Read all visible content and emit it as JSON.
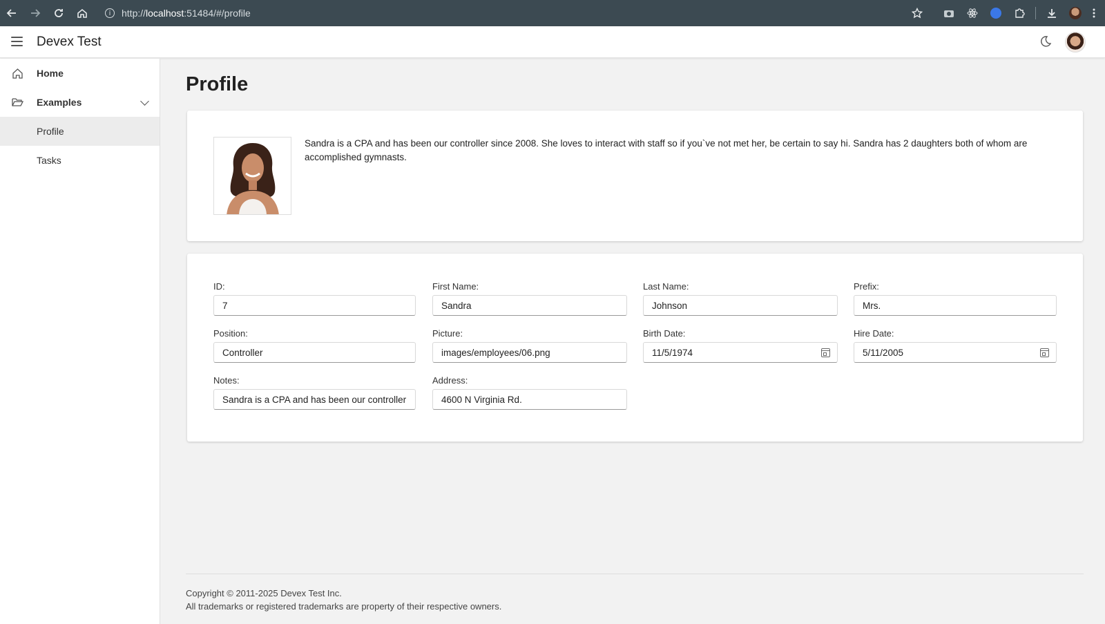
{
  "browser": {
    "url_prefix": "http://",
    "url_host": "localhost",
    "url_rest": ":51484/#/profile"
  },
  "header": {
    "title": "Devex Test"
  },
  "sidebar": {
    "items": [
      {
        "label": "Home"
      },
      {
        "label": "Examples"
      },
      {
        "label": "Profile"
      },
      {
        "label": "Tasks"
      }
    ]
  },
  "page": {
    "title": "Profile"
  },
  "profile": {
    "bio": "Sandra is a CPA and has been our controller since 2008. She loves to interact with staff so if you`ve not met her, be certain to say hi. Sandra has 2 daughters both of whom are accomplished gymnasts."
  },
  "form": {
    "id_label": "ID:",
    "id_value": "7",
    "first_name_label": "First Name:",
    "first_name_value": "Sandra",
    "last_name_label": "Last Name:",
    "last_name_value": "Johnson",
    "prefix_label": "Prefix:",
    "prefix_value": "Mrs.",
    "position_label": "Position:",
    "position_value": "Controller",
    "picture_label": "Picture:",
    "picture_value": "images/employees/06.png",
    "birth_date_label": "Birth Date:",
    "birth_date_value": "11/5/1974",
    "hire_date_label": "Hire Date:",
    "hire_date_value": "5/11/2005",
    "notes_label": "Notes:",
    "notes_value": "Sandra is a CPA and has been our controller",
    "address_label": "Address:",
    "address_value": "4600 N Virginia Rd."
  },
  "footer": {
    "copyright": "Copyright © 2011-2025 Devex Test Inc.",
    "trademarks": "All trademarks or registered trademarks are property of their respective owners."
  }
}
